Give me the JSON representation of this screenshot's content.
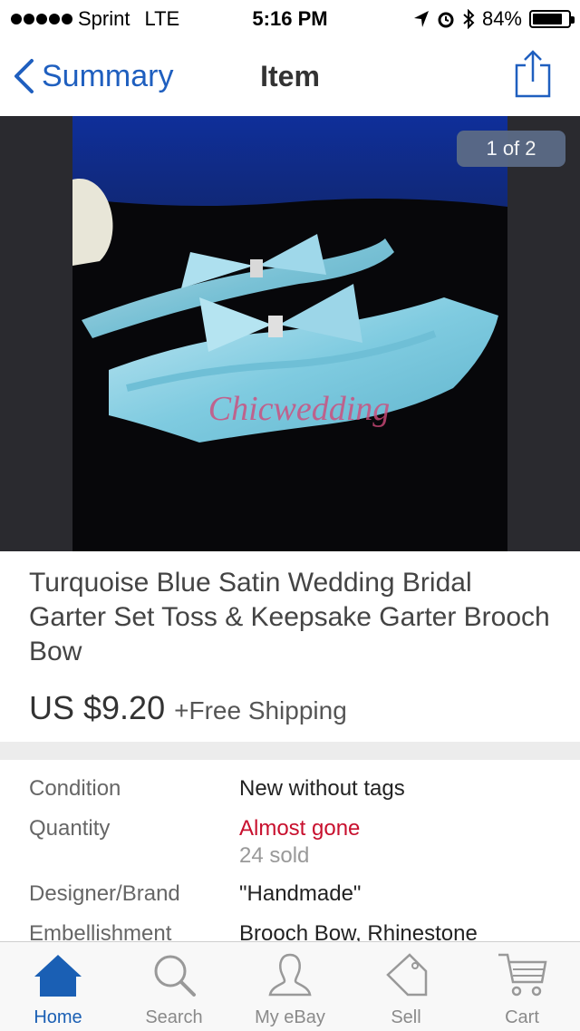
{
  "status": {
    "carrier": "Sprint",
    "network": "LTE",
    "time": "5:16 PM",
    "battery": "84%"
  },
  "nav": {
    "back_label": "Summary",
    "title": "Item"
  },
  "gallery": {
    "pager": "1 of 2",
    "watermark": "Chicwedding"
  },
  "item": {
    "title": "Turquoise Blue Satin Wedding Bridal Garter Set Toss & Keepsake Garter Brooch Bow",
    "price": "US $9.20",
    "shipping": "+Free Shipping"
  },
  "details": [
    {
      "label": "Condition",
      "value": "New without tags"
    },
    {
      "label": "Quantity",
      "value": "Almost gone",
      "sub": "24 sold"
    },
    {
      "label": "Designer/Brand",
      "value": "\"Handmade\""
    },
    {
      "label": "Embellishment",
      "value": "Brooch Bow, Rhinestone"
    }
  ],
  "tabs": [
    {
      "label": "Home",
      "icon": "home-icon"
    },
    {
      "label": "Search",
      "icon": "search-icon"
    },
    {
      "label": "My eBay",
      "icon": "user-icon"
    },
    {
      "label": "Sell",
      "icon": "tag-icon"
    },
    {
      "label": "Cart",
      "icon": "cart-icon"
    }
  ],
  "colors": {
    "accent": "#1f5fbf",
    "alert": "#c8102e"
  }
}
